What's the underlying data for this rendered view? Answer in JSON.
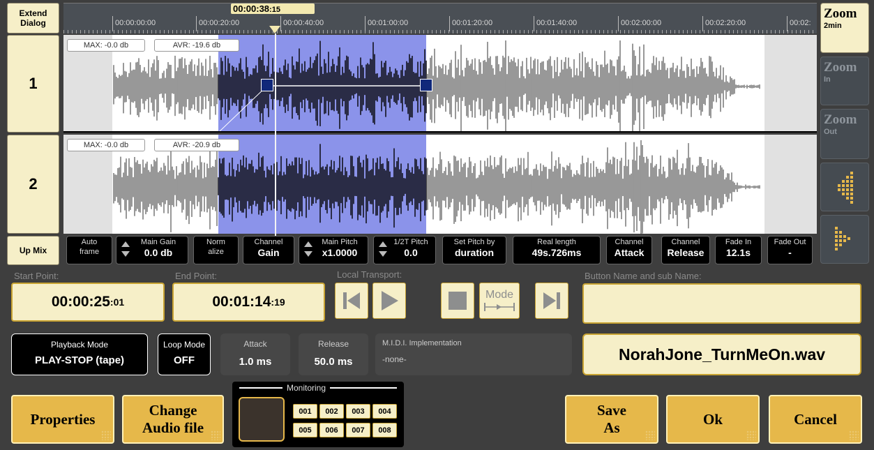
{
  "left": {
    "extend_dialog": "Extend Dialog",
    "track1": "1",
    "track2": "2",
    "up_mix": "Up Mix"
  },
  "timeline": {
    "playhead_time_main": "00:00:38",
    "playhead_time_frames": ":15",
    "ticks": [
      "00:00:00:00",
      "00:00:20:00",
      "00:00:40:00",
      "00:01:00:00",
      "00:01:20:00",
      "00:01:40:00",
      "00:02:00:00",
      "00:02:20:00",
      "00:02:"
    ]
  },
  "tracks": {
    "track1": {
      "max": "MAX: -0.0 db",
      "avr": "AVR: -19.6 db"
    },
    "track2": {
      "max": "MAX: -0.0 db",
      "avr": "AVR: -20.9 db"
    }
  },
  "side": {
    "zoom_2min": {
      "title": "Zoom",
      "sub": "2min"
    },
    "zoom_in": {
      "title": "Zoom",
      "sub": "In"
    },
    "zoom_out": {
      "title": "Zoom",
      "sub": "Out"
    }
  },
  "params": {
    "auto_frame": {
      "l1": "Auto",
      "l2": "frame"
    },
    "main_gain": {
      "label": "Main Gain",
      "value": "0.0 db"
    },
    "normalize": {
      "l1": "Norm",
      "l2": "alize"
    },
    "channel_gain": {
      "label": "Channel",
      "value": "Gain"
    },
    "main_pitch": {
      "label": "Main Pitch",
      "value": "x1.0000"
    },
    "half_pitch": {
      "label": "1/2T Pitch",
      "value": "0.0"
    },
    "set_pitch": {
      "label": "Set Pitch by",
      "value": "duration"
    },
    "real_length": {
      "label": "Real length",
      "value": "49s.726ms"
    },
    "channel_attack": {
      "label": "Channel",
      "value": "Attack"
    },
    "channel_release": {
      "label": "Channel",
      "value": "Release"
    },
    "fade_in": {
      "label": "Fade In",
      "value": "12.1s"
    },
    "fade_out": {
      "label": "Fade Out",
      "value": "-"
    }
  },
  "bottom": {
    "start_label": "Start Point:",
    "start_main": "00:00:25",
    "start_frames": ":01",
    "end_label": "End Point:",
    "end_main": "00:01:14",
    "end_frames": ":19",
    "transport_label": "Local Transport:",
    "mode_label": "Mode",
    "button_name_label": "Button Name and sub Name:",
    "button_name_value": "",
    "playback_mode_label": "Playback Mode",
    "playback_mode_value": "PLAY-STOP (tape)",
    "loop_mode_label": "Loop Mode",
    "loop_mode_value": "OFF",
    "attack_label": "Attack",
    "attack_value": "1.0 ms",
    "release_label": "Release",
    "release_value": "50.0 ms",
    "midi_label": "M.I.D.I. Implementation",
    "midi_value": "-none-",
    "file_name": "NorahJone_TurnMeOn.wav",
    "properties": "Properties",
    "change_audio_1": "Change",
    "change_audio_2": "Audio file",
    "monitoring_label": "Monitoring",
    "monitor_channels": [
      "001",
      "002",
      "003",
      "004",
      "005",
      "006",
      "007",
      "008"
    ],
    "save_as_1": "Save",
    "save_as_2": "As",
    "ok": "Ok",
    "cancel": "Cancel"
  },
  "colors": {
    "background": "#3e3e3e",
    "tan": "#f6efc8",
    "gold": "#e6b84a",
    "selection": "#8b93ea",
    "gain_node": "#10287a"
  }
}
